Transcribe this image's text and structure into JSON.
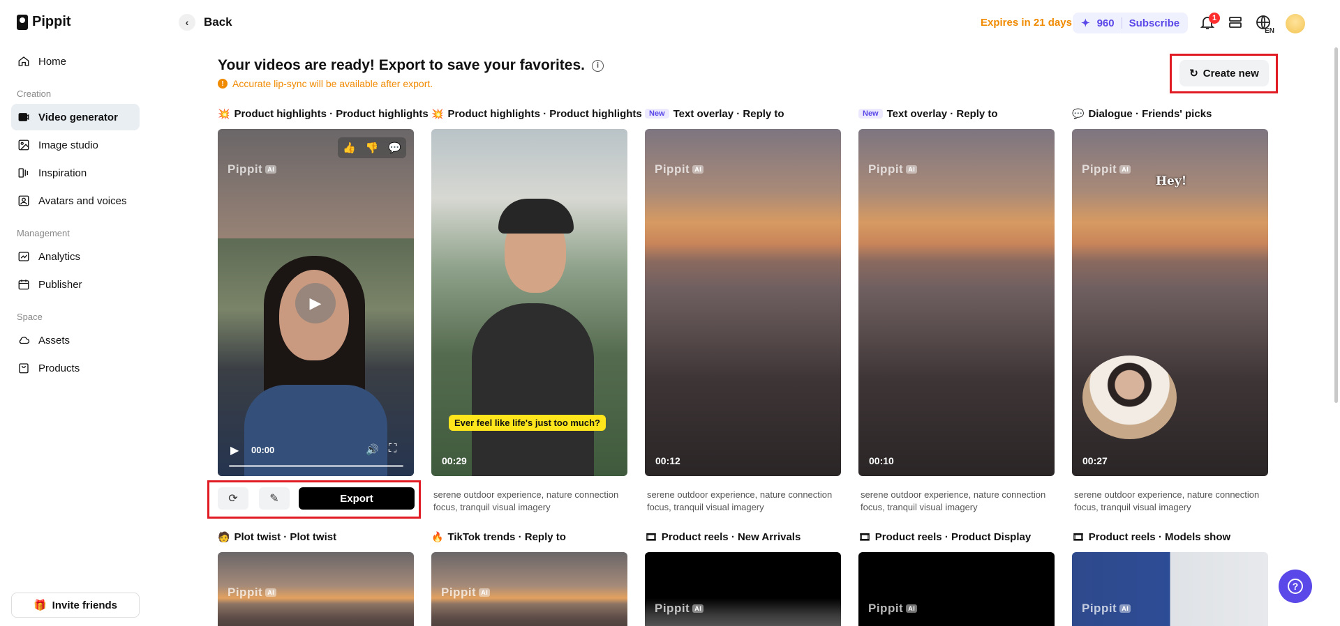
{
  "app": {
    "name": "Pippit"
  },
  "sidebar": {
    "items": [
      {
        "label": "Home",
        "icon": "home-icon"
      },
      {
        "section": "Creation"
      },
      {
        "label": "Video generator",
        "icon": "video-generator-icon",
        "active": true
      },
      {
        "label": "Image studio",
        "icon": "image-studio-icon"
      },
      {
        "label": "Inspiration",
        "icon": "inspiration-icon"
      },
      {
        "label": "Avatars and voices",
        "icon": "avatar-icon"
      },
      {
        "section": "Management"
      },
      {
        "label": "Analytics",
        "icon": "analytics-icon"
      },
      {
        "label": "Publisher",
        "icon": "calendar-icon"
      },
      {
        "section": "Space"
      },
      {
        "label": "Assets",
        "icon": "cloud-icon"
      },
      {
        "label": "Products",
        "icon": "bag-icon"
      }
    ],
    "sections": {
      "creation": "Creation",
      "management": "Management",
      "space": "Space"
    },
    "invite_label": "Invite friends"
  },
  "topbar": {
    "back_label": "Back",
    "expires": "Expires in 21 days",
    "credits": "960",
    "subscribe": "Subscribe",
    "notification_count": "1",
    "language": "EN"
  },
  "main": {
    "heading": "Your videos are ready! Export to save your favorites.",
    "notice": "Accurate lip-sync will be available after export.",
    "create_new": "Create new",
    "export_label": "Export",
    "watermark": "Pippit",
    "watermark_ai": "AI",
    "player_time": "00:00",
    "caption_text": "Ever feel like life's just too much?",
    "hey_text": "Hey!",
    "cards_row1": [
      {
        "title": "Product highlights · Product highlights",
        "duration": "",
        "desc": ""
      },
      {
        "title": "Product highlights · Product highlights",
        "duration": "00:29",
        "desc": "serene outdoor experience, nature connection focus, tranquil visual imagery"
      },
      {
        "new": "New",
        "title": "Text overlay · Reply to",
        "duration": "00:12",
        "desc": "serene outdoor experience, nature connection focus, tranquil visual imagery"
      },
      {
        "new": "New",
        "title": "Text overlay · Reply to",
        "duration": "00:10",
        "desc": "serene outdoor experience, nature connection focus, tranquil visual imagery"
      },
      {
        "title": "Dialogue · Friends' picks",
        "duration": "00:27",
        "desc": "serene outdoor experience, nature connection focus, tranquil visual imagery"
      }
    ],
    "cards_row2": [
      {
        "title": "Plot twist · Plot twist"
      },
      {
        "title": "TikTok trends · Reply to"
      },
      {
        "title": "Product reels · New Arrivals"
      },
      {
        "title": "Product reels · Product Display"
      },
      {
        "title": "Product reels · Models show"
      }
    ]
  },
  "colors": {
    "accent": "#5a48e8",
    "warning": "#f08a00",
    "highlight_border": "#e01b24"
  }
}
